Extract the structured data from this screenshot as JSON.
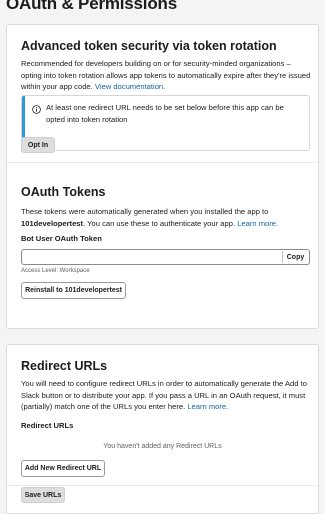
{
  "page": {
    "title": "OAuth & Permissions"
  },
  "token_rotation": {
    "title": "Advanced token security via token rotation",
    "description": "Recommended for developers building on or for security-minded organizations – opting into token rotation allows app tokens to automatically expire after they're issued within your app code.",
    "doc_link": "View documentation.",
    "notice": "At least one redirect URL needs to be set below before this app can be opted into token rotation",
    "notice_icon": "info-icon",
    "notice_color": "#2c9bd6",
    "opt_in_label": "Opt In"
  },
  "oauth_tokens": {
    "title": "OAuth Tokens",
    "desc_before": "These tokens were automatically generated when you installed the app to ",
    "workspace": "101developertest",
    "desc_after": ". You can use these to authenticate your app.",
    "learn_more": "Learn more.",
    "bot_token_label": "Bot User OAuth Token",
    "bot_token_value": "",
    "copy_label": "Copy",
    "access_level": "Access Level: Workspace",
    "reinstall_label": "Reinstall to 101developertest"
  },
  "redirect_urls": {
    "title": "Redirect URLs",
    "description": "You will need to configure redirect URLs in order to automatically generate the Add to Slack button or to distribute your app. If you pass a URL in an OAuth request, it must (partially) match one of the URLs you enter here.",
    "learn_more": "Learn more.",
    "section_label": "Redirect URLs",
    "empty_message": "You haven't added any Redirect URLs",
    "add_button": "Add New Redirect URL",
    "save_button": "Save URLs"
  },
  "colors": {
    "link": "#1264a3",
    "text": "#1d1c1d",
    "page_background": "#f4f4f4"
  }
}
